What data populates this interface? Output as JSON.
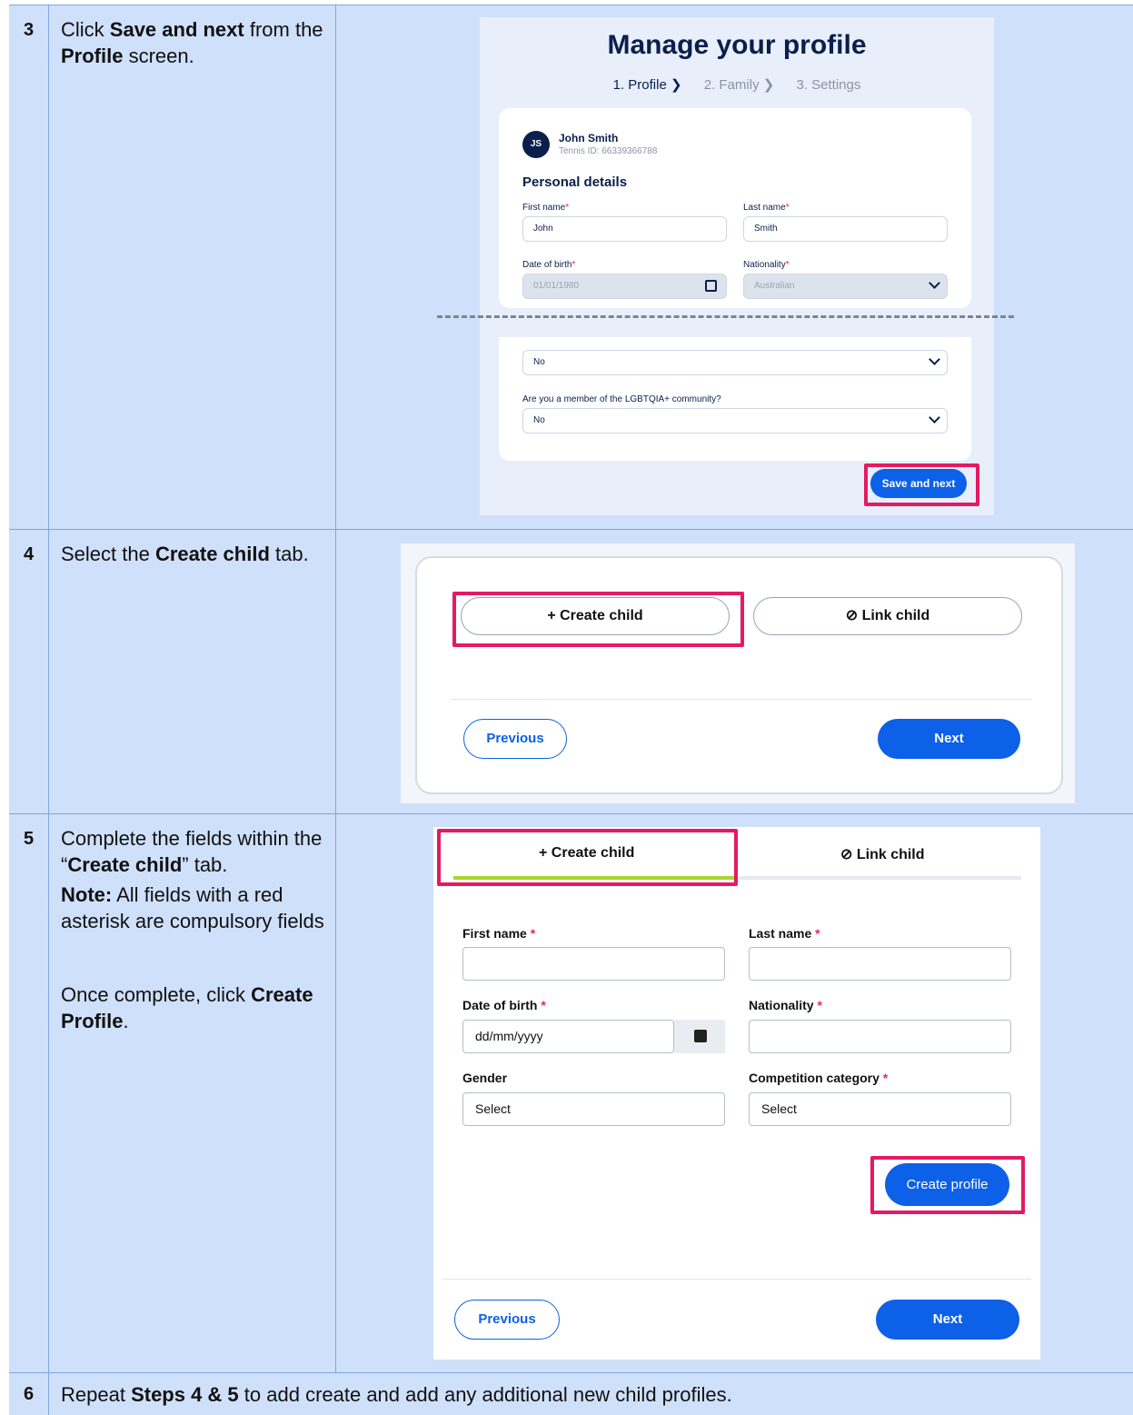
{
  "rows": [
    {
      "num": "3",
      "instruction": {
        "pre": "Click ",
        "b1": "Save and next",
        "mid": " from the ",
        "b2": "Profile",
        "post": " screen."
      },
      "shot": {
        "title": "Manage your profile",
        "steps": [
          "1. Profile ❯",
          "2. Family ❯",
          "3. Settings"
        ],
        "avatar": "JS",
        "user_name": "John Smith",
        "user_id": "Tennis ID: 66339366788",
        "section": "Personal details",
        "first_name_label": "First name",
        "first_name_value": "John",
        "last_name_label": "Last name",
        "last_name_value": "Smith",
        "dob_label": "Date of birth",
        "dob_value": "01/01/1980",
        "nationality_label": "Nationality",
        "nationality_value": "Australian",
        "hidden_select_value": "No",
        "lgbt_label": "Are you a member of the LGBTQIA+ community?",
        "lgbt_value": "No",
        "save_label": "Save and next"
      }
    },
    {
      "num": "4",
      "instruction": {
        "pre": "Select the ",
        "b1": "Create child",
        "post": " tab."
      },
      "shot": {
        "create_child": "+  Create child",
        "link_child": "⊘  Link child",
        "previous": "Previous",
        "next": "Next"
      }
    },
    {
      "num": "5",
      "instruction": {
        "pre": "Complete the fields within the “",
        "b1": "Create child",
        "post": "” tab.",
        "note_b": "Note:",
        "note": " All fields with a red asterisk are compulsory fields",
        "done_pre": "Once complete, click ",
        "done_b": "Create Profile",
        "done_post": "."
      },
      "shot": {
        "tab_create": "+  Create child",
        "tab_link": "⊘  Link child",
        "first_name_label": "First name",
        "last_name_label": "Last name",
        "dob_label": "Date of birth",
        "dob_placeholder": "dd/mm/yyyy",
        "nationality_label": "Nationality",
        "gender_label": "Gender",
        "gender_value": "Select",
        "competition_label": "Competition category",
        "competition_value": "Select",
        "create_profile": "Create profile",
        "previous": "Previous",
        "next": "Next"
      }
    }
  ],
  "row6": {
    "num": "6",
    "pre": "Repeat ",
    "b": "Steps 4 & 5",
    "post": " to add create and add any additional new child profiles."
  },
  "asterisk": "*"
}
